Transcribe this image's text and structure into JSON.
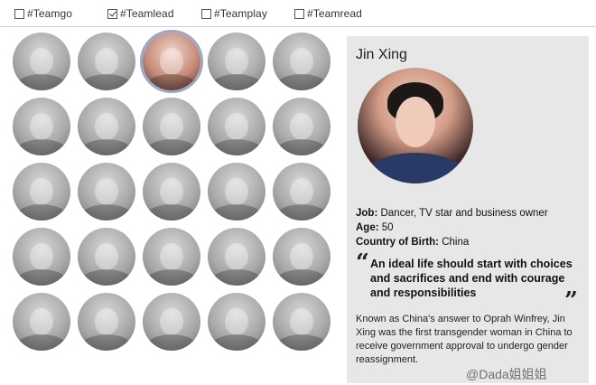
{
  "filters": [
    {
      "label": "#Teamgo",
      "checked": false
    },
    {
      "label": "#Teamlead",
      "checked": true
    },
    {
      "label": "#Teamplay",
      "checked": false
    },
    {
      "label": "#Teamread",
      "checked": false
    }
  ],
  "profile": {
    "name": "Jin Xing",
    "job_key": "Job:",
    "job": "Dancer, TV star and business owner",
    "age_key": "Age:",
    "age": "50",
    "country_key": "Country of Birth:",
    "country": "China",
    "quote": "An ideal life should start with choices and sacrifices and end with courage and responsibilities",
    "bio": "Known as China's answer to Oprah Winfrey, Jin Xing was the first transgender woman in China to receive government approval to undergo gender reassignment."
  },
  "watermark": "@Dada姐姐姐"
}
